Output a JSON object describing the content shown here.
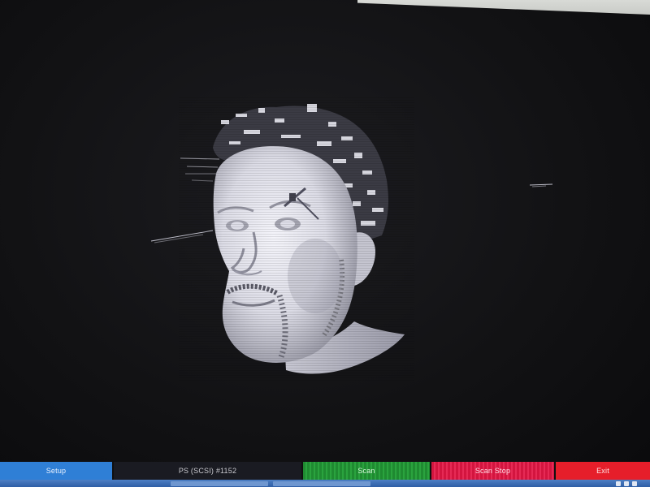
{
  "viewport": {
    "subject": "3d-head-scan-mesh",
    "background_color": "#131316",
    "mesh_color": "#e6e6ee"
  },
  "toolbar": {
    "setup_label": "Setup",
    "status_label": "PS (SCSI) #1152",
    "scan_label": "Scan",
    "scan_stop_label": "Scan Stop",
    "exit_label": "Exit"
  },
  "colors": {
    "setup": "#2f7fd6",
    "scan": "#1f8a31",
    "scan_stop": "#d3153f",
    "exit": "#e61e2a",
    "taskbar": "#3a6bb4"
  }
}
